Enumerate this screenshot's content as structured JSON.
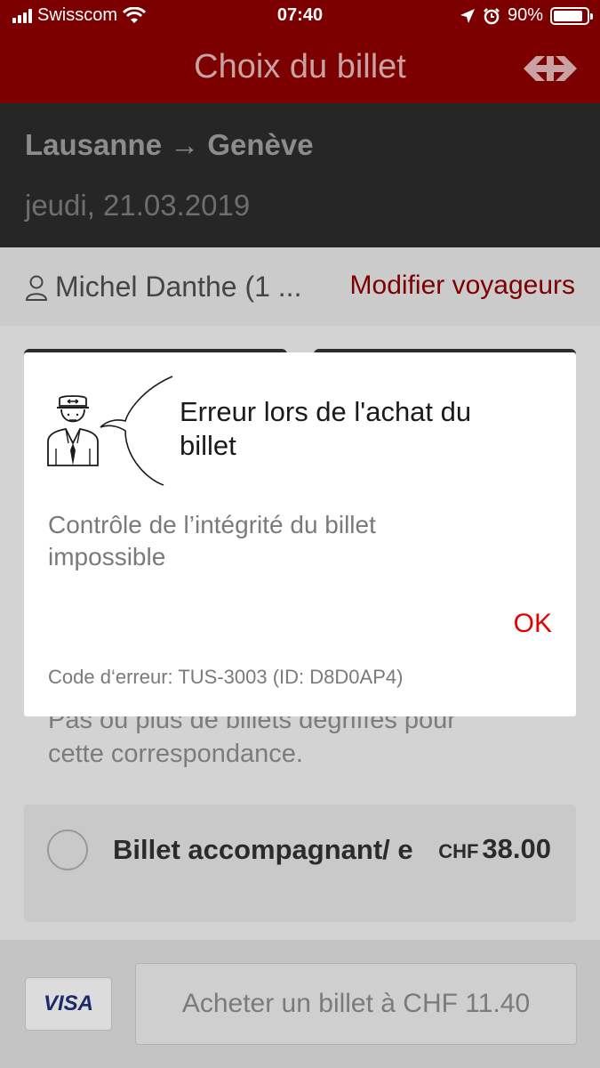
{
  "status_bar": {
    "carrier": "Swisscom",
    "time": "07:40",
    "battery": "90%"
  },
  "header": {
    "title": "Choix du billet",
    "logo_icon": "sbb-logo-icon"
  },
  "route": {
    "text": "Lausanne → Genève",
    "date": "jeudi, 21.03.2019"
  },
  "travellers": {
    "name": "Michel Danthe (1 ...",
    "modify_label": "Modifier voyageurs"
  },
  "background_content": {
    "info_text_line1": "Pas ou plus de billets dégriffés pour",
    "info_text_line2": "cette correspondance.",
    "option": {
      "label": "Billet accompagnant/ e",
      "currency": "CHF",
      "price": "38.00"
    }
  },
  "footer": {
    "payment_method": "VISA",
    "buy_label": "Acheter un billet à CHF 11.40"
  },
  "dialog": {
    "title": "Erreur lors de l'achat du billet",
    "message": "Contrôle de l’intégrité du billet impossible",
    "ok_label": "OK",
    "error_code": "Code d‘erreur: TUS-3003 (ID: D8D0AP4)"
  },
  "colors": {
    "brand_red": "#eb0000",
    "ok_red": "#e40000"
  }
}
